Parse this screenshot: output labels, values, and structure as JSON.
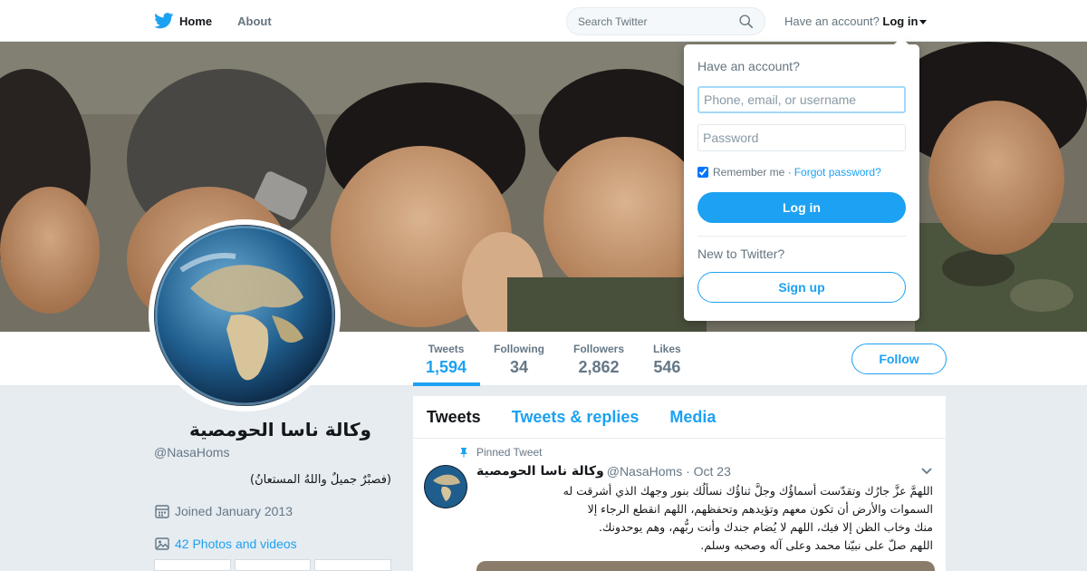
{
  "nav": {
    "home_label": "Home",
    "about_label": "About",
    "search_placeholder": "Search Twitter",
    "account_prompt": "Have an account?",
    "login_label": "Log in"
  },
  "profile": {
    "name": "وكالة ناسا الحومصية",
    "handle": "@NasaHoms",
    "bio": "(فصبْرٌ جميلٌ واللهُ المستعانُ)",
    "joined": "Joined January 2013",
    "photos_videos": "42 Photos and videos"
  },
  "stats": [
    {
      "label": "Tweets",
      "value": "1,594"
    },
    {
      "label": "Following",
      "value": "34"
    },
    {
      "label": "Followers",
      "value": "2,862"
    },
    {
      "label": "Likes",
      "value": "546"
    }
  ],
  "follow_label": "Follow",
  "timeline": {
    "tabs": [
      "Tweets",
      "Tweets & replies",
      "Media"
    ],
    "pinned_label": "Pinned Tweet",
    "tweet": {
      "name": "وكالة ناسا الحومصية",
      "handle": "@NasaHoms",
      "date": "· Oct 23",
      "text_lines": [
        "اللهمَّ عزَّ جارُك وتقدّست أسماؤُك وجلَّ ثناؤُك نسألُك بنور وجهك الذي أشرقت له",
        "السموات والأرض أن تكون معهم وتؤيدهم وتحفظهم، اللهم انقطع الرجاء إلا",
        "منك وخاب الظن إلا فيك، اللهم لا يُضام جندك وأنت ربُّهم، وهم يوحدونك.",
        "اللهم صلّ على نبيّنا محمد وعلى آله وصحبه وسلم."
      ]
    }
  },
  "login_dropdown": {
    "title": "Have an account?",
    "username_placeholder": "Phone, email, or username",
    "password_placeholder": "Password",
    "remember_label": "Remember me",
    "separator": "·",
    "forgot_label": "Forgot password?",
    "login_button": "Log in",
    "new_prompt": "New to Twitter?",
    "signup_button": "Sign up"
  },
  "colors": {
    "accent": "#1da1f2",
    "text": "#14171a",
    "muted": "#657786",
    "background": "#e6ecf0"
  }
}
